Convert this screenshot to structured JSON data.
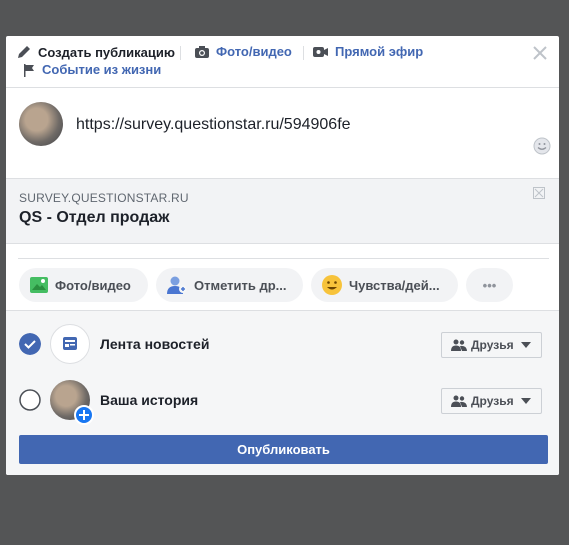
{
  "header": {
    "create_post": "Создать публикацию",
    "photo_video": "Фото/видео",
    "live": "Прямой эфир",
    "life_event": "Событие из жизни"
  },
  "composer": {
    "text": "https://survey.questionstar.ru/594906fe"
  },
  "link_preview": {
    "domain": "SURVEY.QUESTIONSTAR.RU",
    "title": "QS - Отдел продаж"
  },
  "actions": [
    {
      "label": "Фото/видео",
      "icon": "photo-icon"
    },
    {
      "label": "Отметить др...",
      "icon": "tag-friends-icon"
    },
    {
      "label": "Чувства/дей...",
      "icon": "feeling-emoji-icon"
    },
    {
      "label": "•••",
      "icon": "more-icon"
    }
  ],
  "audience": {
    "news_feed_label": "Лента новостей",
    "news_feed_checked": true,
    "story_label": "Ваша история",
    "story_checked": false,
    "privacy_label": "Друзья"
  },
  "publish_label": "Опубликовать",
  "colors": {
    "accent": "#4267b2",
    "overlay": "#545556"
  }
}
